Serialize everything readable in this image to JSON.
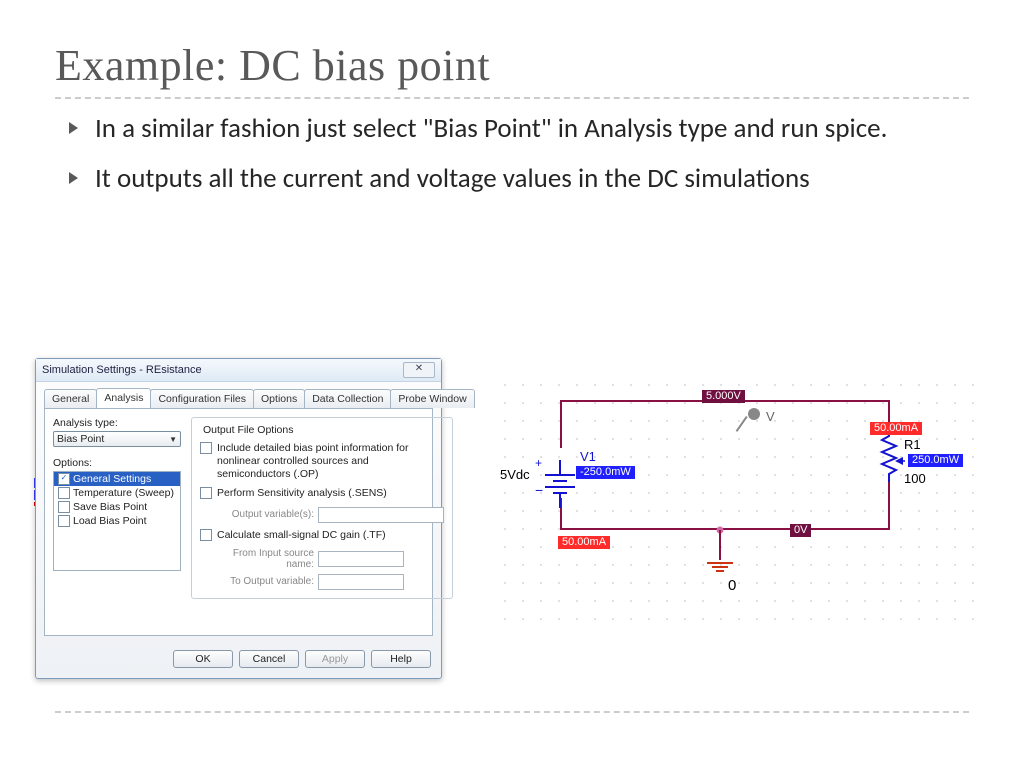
{
  "title": "Example: DC bias point",
  "bullets": [
    "In a similar fashion just select \"Bias Point\" in Analysis type and run spice.",
    "It outputs all the current and voltage values in the DC simulations"
  ],
  "dialog": {
    "title": "Simulation Settings - REsistance",
    "close_glyph": "✕",
    "tabs": [
      "General",
      "Analysis",
      "Configuration Files",
      "Options",
      "Data Collection",
      "Probe Window"
    ],
    "active_tab_index": 1,
    "analysis_type_label": "Analysis type:",
    "analysis_type_value": "Bias Point",
    "options_label": "Options:",
    "options_items": [
      {
        "label": "General Settings",
        "selected": true,
        "checked": true
      },
      {
        "label": "Temperature (Sweep)",
        "selected": false,
        "checked": false
      },
      {
        "label": "Save Bias Point",
        "selected": false,
        "checked": false
      },
      {
        "label": "Load Bias Point",
        "selected": false,
        "checked": false
      }
    ],
    "output_group_title": "Output File Options",
    "opt_op": "Include detailed bias point information for nonlinear controlled sources and semiconductors (.OP)",
    "opt_sens": "Perform Sensitivity analysis (.SENS)",
    "sens_label": "Output variable(s):",
    "opt_tf": "Calculate small-signal DC gain (.TF)",
    "tf_from_label": "From Input source name:",
    "tf_to_label": "To Output variable:",
    "buttons": {
      "ok": "OK",
      "cancel": "Cancel",
      "apply": "Apply",
      "help": "Help"
    }
  },
  "circuit": {
    "source_value": "5Vdc",
    "source_name": "V1",
    "resistor_name": "R1",
    "resistor_value": "100",
    "ground_label": "0",
    "probe_label": "V",
    "markers": {
      "node_top": "5.000V",
      "node_bottom": "0V",
      "i_top_right": "50.00mA",
      "i_bottom_left": "50.00mA",
      "p_source": "-250.0mW",
      "p_resistor": "250.0mW"
    }
  }
}
